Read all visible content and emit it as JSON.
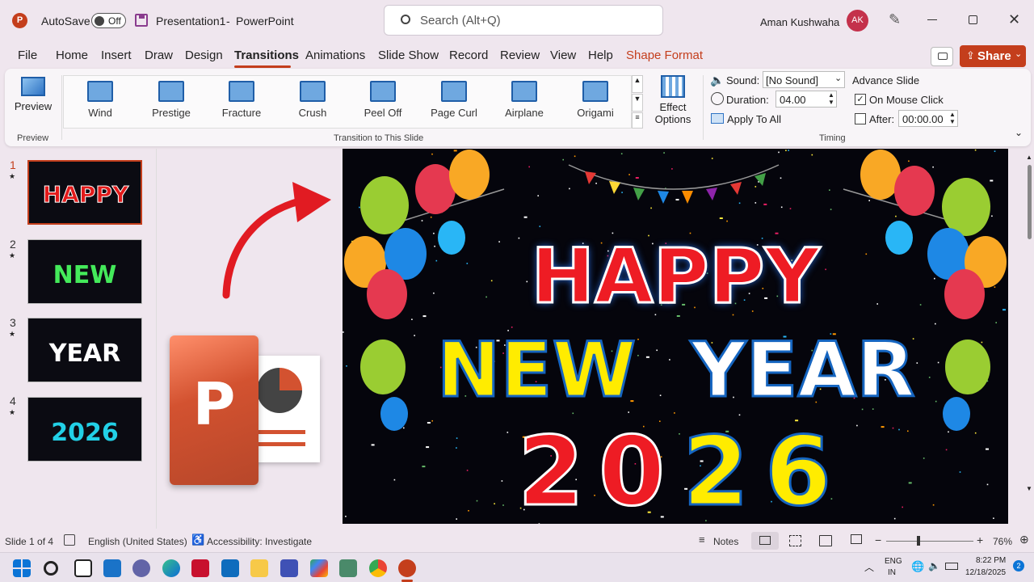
{
  "titlebar": {
    "autosave_label": "AutoSave",
    "autosave_state": "Off",
    "filename": "Presentation1",
    "separator": "-",
    "app_name": "PowerPoint",
    "search_placeholder": "Search (Alt+Q)",
    "user_name": "Aman Kushwaha",
    "user_initials": "AK"
  },
  "tabs": [
    "File",
    "Home",
    "Insert",
    "Draw",
    "Design",
    "Transitions",
    "Animations",
    "Slide Show",
    "Record",
    "Review",
    "View",
    "Help",
    "Shape Format"
  ],
  "active_tab": "Transitions",
  "share_label": "Share",
  "ribbon": {
    "preview_label": "Preview",
    "preview_group": "Preview",
    "transitions": [
      "Wind",
      "Prestige",
      "Fracture",
      "Crush",
      "Peel Off",
      "Page Curl",
      "Airplane",
      "Origami"
    ],
    "effect_options_line1": "Effect",
    "effect_options_line2": "Options",
    "transition_group": "Transition to This Slide",
    "sound_label": "Sound:",
    "sound_value": "[No Sound]",
    "duration_label": "Duration:",
    "duration_value": "04.00",
    "apply_all_label": "Apply To All",
    "advance_label": "Advance Slide",
    "mouse_click_label": "On Mouse Click",
    "after_label": "After:",
    "after_value": "00:00.00",
    "timing_group": "Timing"
  },
  "slides": [
    {
      "num": "1",
      "text": "HAPPY"
    },
    {
      "num": "2",
      "text": "NEW"
    },
    {
      "num": "3",
      "text": "YEAR"
    },
    {
      "num": "4",
      "text": "2026"
    }
  ],
  "slide_content": {
    "line1": "HAPPY",
    "line2a": "NEW",
    "line2b": "YEAR",
    "year": [
      "2",
      "0",
      "2",
      "6"
    ]
  },
  "status": {
    "slide_count": "Slide 1 of 4",
    "language": "English (United States)",
    "accessibility": "Accessibility: Investigate",
    "notes": "Notes",
    "zoom": "76%"
  },
  "taskbar": {
    "lang1": "ENG",
    "lang2": "IN",
    "time": "8:22 PM",
    "date": "12/18/2025",
    "notif_count": "2"
  },
  "colors": {
    "accent": "#c43e1c",
    "share_bg": "#c43e1c",
    "active_tab_underline": "#c43e1c",
    "avatar_bg": "#c4314b"
  }
}
